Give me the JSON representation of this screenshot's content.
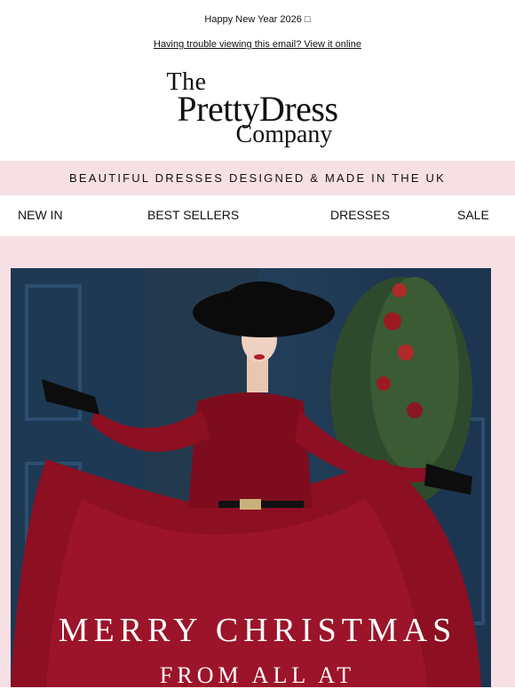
{
  "preheader": {
    "text": "Happy New Year 2026 □"
  },
  "view_online": {
    "text": "Having trouble viewing this email? View it online"
  },
  "logo": {
    "line1": "The",
    "line2": "PrettyDress",
    "line3": "Company"
  },
  "tagline": {
    "text": "BEAUTIFUL DRESSES DESIGNED & MADE IN THE UK"
  },
  "nav": {
    "items": [
      {
        "label": "NEW IN"
      },
      {
        "label": "BEST SELLERS"
      },
      {
        "label": "DRESSES"
      },
      {
        "label": "SALE"
      }
    ]
  },
  "hero": {
    "headline": "MERRY CHRISTMAS",
    "subline": "FROM ALL AT"
  },
  "colors": {
    "pink_band": "#f7e0e4",
    "velvet_red": "#8c0f22",
    "door_blue": "#1f3a55"
  }
}
